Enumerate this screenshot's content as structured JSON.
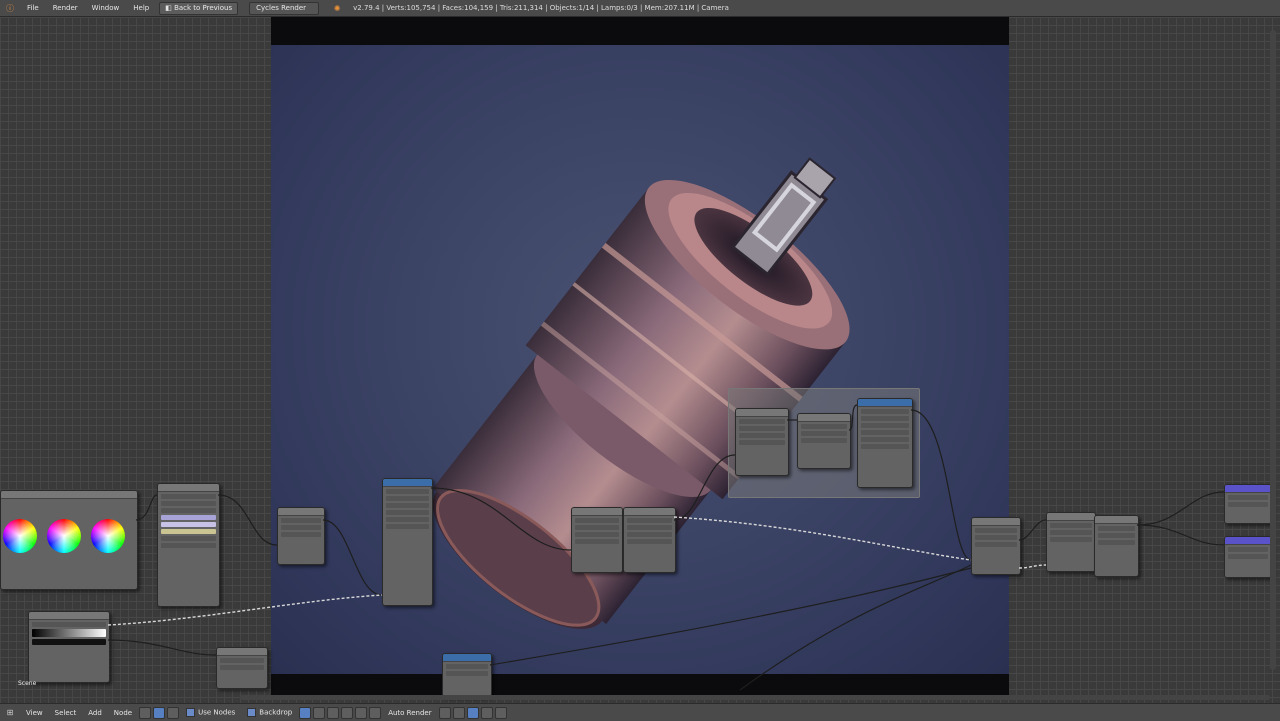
{
  "topbar": {
    "menu": [
      "File",
      "Render",
      "Window",
      "Help"
    ],
    "back_button": "Back to Previous",
    "engine": "Cycles Render",
    "stats": "v2.79.4 | Verts:105,754 | Faces:104,159 | Tris:211,314 | Objects:1/14 | Lamps:0/3 | Mem:207.11M | Camera"
  },
  "bottombar": {
    "menu": [
      "View",
      "Select",
      "Add",
      "Node"
    ],
    "use_nodes_label": "Use Nodes",
    "backdrop_label": "Backdrop",
    "auto_render_label": "Auto Render"
  },
  "scene_label": "Scene",
  "colors": {
    "header_bg": "#4a4a4a",
    "grid_bg": "#3a3a3a",
    "render_bg": "#3c4466",
    "accent_orange": "#e8913a",
    "node_header_blue": "#3b6ea8",
    "node_header_purple": "#5a52c9"
  }
}
